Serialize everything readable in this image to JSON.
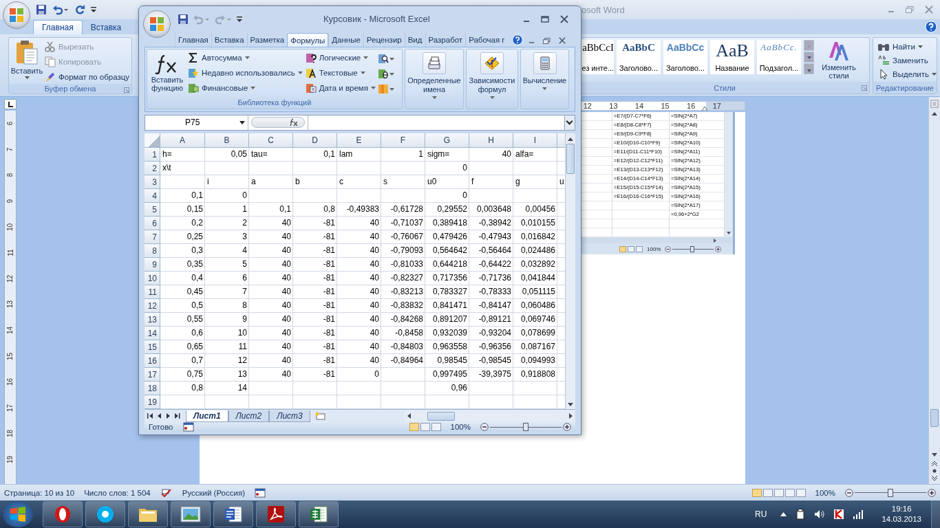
{
  "word": {
    "title": "osoft Word",
    "tabs": [
      {
        "label": "Главная",
        "selected": true
      },
      {
        "label": "Вставка",
        "selected": false
      }
    ],
    "clipboard": {
      "paste": "Вставить",
      "actions": [
        {
          "label": "Вырезать",
          "disabled": true,
          "kind": "cut"
        },
        {
          "label": "Копировать",
          "disabled": true,
          "kind": "copy"
        },
        {
          "label": "Формат по образцу",
          "disabled": false,
          "kind": "brush"
        }
      ],
      "group": "Буфер обмена"
    },
    "styles": {
      "items": [
        {
          "sample": "aBbCcI",
          "name": "ез инте...",
          "kind": "plain"
        },
        {
          "sample": "AaBbC",
          "name": "Заголово...",
          "kind": "heading1"
        },
        {
          "sample": "AaBbCc",
          "name": "Заголово...",
          "kind": "heading2"
        },
        {
          "sample": "AaB",
          "name": "Название",
          "kind": "title"
        },
        {
          "sample": "AaBbCc.",
          "name": "Подзагол...",
          "kind": "subtitle"
        }
      ],
      "change": "Изменить стили",
      "group": "Стили"
    },
    "editing": {
      "items": [
        {
          "label": "Найти",
          "kind": "find",
          "dropdown": true
        },
        {
          "label": "Заменить",
          "kind": "replace",
          "dropdown": false
        },
        {
          "label": "Выделить",
          "kind": "select",
          "dropdown": true
        }
      ],
      "group": "Редактирование"
    },
    "ruler": [
      "12",
      "13",
      "14",
      "15",
      "16",
      "17"
    ],
    "vertical_ruler": [
      "6",
      "7",
      "8",
      "9",
      "10",
      "11",
      "12",
      "13",
      "14",
      "15",
      "16",
      "17",
      "18",
      "19"
    ],
    "embedded": {
      "rows": [
        [
          "=E7/(D7-C7*F6)",
          "=SIN(2*A7)"
        ],
        [
          "=E8/(D8-C8*F7)",
          "=SIN(2*A8)"
        ],
        [
          "=E9/(D9-C9*F8)",
          "=SIN(2*A9)"
        ],
        [
          "=E10/(D10-C10*F9)",
          "=SIN(2*A10)"
        ],
        [
          "=E11/(D11-C11*F10)",
          "=SIN(2*A11)"
        ],
        [
          "=E12/(D12-C12*F11)",
          "=SIN(2*A12)"
        ],
        [
          "=E13/(D13-C13*F12)",
          "=SIN(2*A13)"
        ],
        [
          "=E14/(D14-C14*F13)",
          "=SIN(2*A14)"
        ],
        [
          "=E15/(D15-C15*F14)",
          "=SIN(2*A15)"
        ],
        [
          "=E16/(D16-C16*F15)",
          "=SIN(2*A16)"
        ],
        [
          null,
          "=SIN(2*A17)"
        ],
        [
          null,
          "=0,96+2*G2"
        ]
      ],
      "zoom": "100%",
      "zoom_slider": {
        "level": 0.5
      }
    },
    "status": {
      "page": "Страница: 10 из 10",
      "words": "Число слов: 1 504",
      "language": "Русский (Россия)",
      "zoom": "100%",
      "zoom_slider": {
        "level": 0.5
      }
    }
  },
  "excel": {
    "title": "Курсовик - Microsoft Excel",
    "tabs": [
      {
        "label": "Главная",
        "selected": false
      },
      {
        "label": "Вставка",
        "selected": false
      },
      {
        "label": "Разметка",
        "selected": false
      },
      {
        "label": "Формулы",
        "selected": true
      },
      {
        "label": "Данные",
        "selected": false
      },
      {
        "label": "Рецензир",
        "selected": false
      },
      {
        "label": "Вид",
        "selected": false
      },
      {
        "label": "Разработ",
        "selected": false
      },
      {
        "label": "Рабочая г",
        "selected": false
      }
    ],
    "library": {
      "insert": "Вставить функцию",
      "items": [
        {
          "label": "Автосумма",
          "kind": "sum"
        },
        {
          "label": "Недавно использовались",
          "kind": "recent"
        },
        {
          "label": "Финансовые",
          "kind": "finance"
        },
        {
          "label": "Логические",
          "kind": "logic"
        },
        {
          "label": "Текстовые",
          "kind": "text"
        },
        {
          "label": "Дата и время",
          "kind": "date"
        }
      ],
      "group": "Библиотека функций"
    },
    "groups": [
      {
        "label": "Определенные имена",
        "kind": "names"
      },
      {
        "label": "Зависимости формул",
        "kind": "audit"
      },
      {
        "label": "Вычисление",
        "kind": "calc"
      }
    ],
    "name_box": "P75",
    "columns": [
      "A",
      "B",
      "C",
      "D",
      "E",
      "F",
      "G",
      "H",
      "I"
    ],
    "rows": [
      {
        "n": "1",
        "cells": [
          {
            "text": "h=",
            "kind": "text"
          },
          {
            "text": "0,05",
            "kind": "number"
          },
          {
            "text": "tau=",
            "kind": "text"
          },
          {
            "text": "0,1",
            "kind": "number"
          },
          {
            "text": "lam",
            "kind": "text"
          },
          {
            "text": "1",
            "kind": "number"
          },
          {
            "text": "sigm=",
            "kind": "text"
          },
          {
            "text": "40",
            "kind": "number"
          },
          {
            "text": "alfa=",
            "kind": "text"
          },
          null
        ]
      },
      {
        "n": "2",
        "cells": [
          {
            "text": "x\\t",
            "kind": "text"
          },
          null,
          null,
          null,
          null,
          null,
          {
            "text": "0",
            "kind": "number"
          },
          null,
          null,
          null
        ]
      },
      {
        "n": "3",
        "cells": [
          null,
          {
            "text": "i",
            "kind": "text"
          },
          {
            "text": "a",
            "kind": "text"
          },
          {
            "text": "b",
            "kind": "text"
          },
          {
            "text": "c",
            "kind": "text"
          },
          {
            "text": "s",
            "kind": "text"
          },
          {
            "text": "u0",
            "kind": "text"
          },
          {
            "text": "f",
            "kind": "text"
          },
          {
            "text": "g",
            "kind": "text"
          },
          {
            "text": "u",
            "kind": "text"
          }
        ]
      },
      {
        "n": "4",
        "cells": [
          {
            "text": "0,1",
            "kind": "number"
          },
          {
            "text": "0",
            "kind": "number"
          },
          null,
          null,
          null,
          null,
          {
            "text": "0",
            "kind": "number"
          },
          null,
          null,
          null
        ]
      },
      {
        "n": "5",
        "cells": [
          {
            "text": "0,15",
            "kind": "number"
          },
          {
            "text": "1",
            "kind": "number"
          },
          {
            "text": "0,1",
            "kind": "number"
          },
          {
            "text": "0,8",
            "kind": "number"
          },
          {
            "text": "-0,49383",
            "kind": "number"
          },
          {
            "text": "-0,61728",
            "kind": "number"
          },
          {
            "text": "0,29552",
            "kind": "number"
          },
          {
            "text": "0,003648",
            "kind": "number"
          },
          {
            "text": "0,00456",
            "kind": "number"
          },
          null
        ]
      },
      {
        "n": "6",
        "cells": [
          {
            "text": "0,2",
            "kind": "number"
          },
          {
            "text": "2",
            "kind": "number"
          },
          {
            "text": "40",
            "kind": "number"
          },
          {
            "text": "-81",
            "kind": "number"
          },
          {
            "text": "40",
            "kind": "number"
          },
          {
            "text": "-0,71037",
            "kind": "number"
          },
          {
            "text": "0,389418",
            "kind": "number"
          },
          {
            "text": "-0,38942",
            "kind": "number"
          },
          {
            "text": "0,010155",
            "kind": "number"
          },
          null
        ]
      },
      {
        "n": "7",
        "cells": [
          {
            "text": "0,25",
            "kind": "number"
          },
          {
            "text": "3",
            "kind": "number"
          },
          {
            "text": "40",
            "kind": "number"
          },
          {
            "text": "-81",
            "kind": "number"
          },
          {
            "text": "40",
            "kind": "number"
          },
          {
            "text": "-0,76067",
            "kind": "number"
          },
          {
            "text": "0,479426",
            "kind": "number"
          },
          {
            "text": "-0,47943",
            "kind": "number"
          },
          {
            "text": "0,016842",
            "kind": "number"
          },
          null
        ]
      },
      {
        "n": "8",
        "cells": [
          {
            "text": "0,3",
            "kind": "number"
          },
          {
            "text": "4",
            "kind": "number"
          },
          {
            "text": "40",
            "kind": "number"
          },
          {
            "text": "-81",
            "kind": "number"
          },
          {
            "text": "40",
            "kind": "number"
          },
          {
            "text": "-0,79093",
            "kind": "number"
          },
          {
            "text": "0,564642",
            "kind": "number"
          },
          {
            "text": "-0,56464",
            "kind": "number"
          },
          {
            "text": "0,024486",
            "kind": "number"
          },
          null
        ]
      },
      {
        "n": "9",
        "cells": [
          {
            "text": "0,35",
            "kind": "number"
          },
          {
            "text": "5",
            "kind": "number"
          },
          {
            "text": "40",
            "kind": "number"
          },
          {
            "text": "-81",
            "kind": "number"
          },
          {
            "text": "40",
            "kind": "number"
          },
          {
            "text": "-0,81033",
            "kind": "number"
          },
          {
            "text": "0,644218",
            "kind": "number"
          },
          {
            "text": "-0,64422",
            "kind": "number"
          },
          {
            "text": "0,032892",
            "kind": "number"
          },
          null
        ]
      },
      {
        "n": "10",
        "cells": [
          {
            "text": "0,4",
            "kind": "number"
          },
          {
            "text": "6",
            "kind": "number"
          },
          {
            "text": "40",
            "kind": "number"
          },
          {
            "text": "-81",
            "kind": "number"
          },
          {
            "text": "40",
            "kind": "number"
          },
          {
            "text": "-0,82327",
            "kind": "number"
          },
          {
            "text": "0,717356",
            "kind": "number"
          },
          {
            "text": "-0,71736",
            "kind": "number"
          },
          {
            "text": "0,041844",
            "kind": "number"
          },
          null
        ]
      },
      {
        "n": "11",
        "cells": [
          {
            "text": "0,45",
            "kind": "number"
          },
          {
            "text": "7",
            "kind": "number"
          },
          {
            "text": "40",
            "kind": "number"
          },
          {
            "text": "-81",
            "kind": "number"
          },
          {
            "text": "40",
            "kind": "number"
          },
          {
            "text": "-0,83213",
            "kind": "number"
          },
          {
            "text": "0,783327",
            "kind": "number"
          },
          {
            "text": "-0,78333",
            "kind": "number"
          },
          {
            "text": "0,051115",
            "kind": "number"
          },
          null
        ]
      },
      {
        "n": "12",
        "cells": [
          {
            "text": "0,5",
            "kind": "number"
          },
          {
            "text": "8",
            "kind": "number"
          },
          {
            "text": "40",
            "kind": "number"
          },
          {
            "text": "-81",
            "kind": "number"
          },
          {
            "text": "40",
            "kind": "number"
          },
          {
            "text": "-0,83832",
            "kind": "number"
          },
          {
            "text": "0,841471",
            "kind": "number"
          },
          {
            "text": "-0,84147",
            "kind": "number"
          },
          {
            "text": "0,060486",
            "kind": "number"
          },
          null
        ]
      },
      {
        "n": "13",
        "cells": [
          {
            "text": "0,55",
            "kind": "number"
          },
          {
            "text": "9",
            "kind": "number"
          },
          {
            "text": "40",
            "kind": "number"
          },
          {
            "text": "-81",
            "kind": "number"
          },
          {
            "text": "40",
            "kind": "number"
          },
          {
            "text": "-0,84268",
            "kind": "number"
          },
          {
            "text": "0,891207",
            "kind": "number"
          },
          {
            "text": "-0,89121",
            "kind": "number"
          },
          {
            "text": "0,069746",
            "kind": "number"
          },
          null
        ]
      },
      {
        "n": "14",
        "cells": [
          {
            "text": "0,6",
            "kind": "number"
          },
          {
            "text": "10",
            "kind": "number"
          },
          {
            "text": "40",
            "kind": "number"
          },
          {
            "text": "-81",
            "kind": "number"
          },
          {
            "text": "40",
            "kind": "number"
          },
          {
            "text": "-0,8458",
            "kind": "number"
          },
          {
            "text": "0,932039",
            "kind": "number"
          },
          {
            "text": "-0,93204",
            "kind": "number"
          },
          {
            "text": "0,078699",
            "kind": "number"
          },
          null
        ]
      },
      {
        "n": "15",
        "cells": [
          {
            "text": "0,65",
            "kind": "number"
          },
          {
            "text": "11",
            "kind": "number"
          },
          {
            "text": "40",
            "kind": "number"
          },
          {
            "text": "-81",
            "kind": "number"
          },
          {
            "text": "40",
            "kind": "number"
          },
          {
            "text": "-0,84803",
            "kind": "number"
          },
          {
            "text": "0,963558",
            "kind": "number"
          },
          {
            "text": "-0,96356",
            "kind": "number"
          },
          {
            "text": "0,087167",
            "kind": "number"
          },
          null
        ]
      },
      {
        "n": "16",
        "cells": [
          {
            "text": "0,7",
            "kind": "number"
          },
          {
            "text": "12",
            "kind": "number"
          },
          {
            "text": "40",
            "kind": "number"
          },
          {
            "text": "-81",
            "kind": "number"
          },
          {
            "text": "40",
            "kind": "number"
          },
          {
            "text": "-0,84964",
            "kind": "number"
          },
          {
            "text": "0,98545",
            "kind": "number"
          },
          {
            "text": "-0,98545",
            "kind": "number"
          },
          {
            "text": "0,094993",
            "kind": "number"
          },
          null
        ]
      },
      {
        "n": "17",
        "cells": [
          {
            "text": "0,75",
            "kind": "number"
          },
          {
            "text": "13",
            "kind": "number"
          },
          {
            "text": "40",
            "kind": "number"
          },
          {
            "text": "-81",
            "kind": "number"
          },
          {
            "text": "0",
            "kind": "number"
          },
          null,
          {
            "text": "0,997495",
            "kind": "number"
          },
          {
            "text": "-39,3975",
            "kind": "number"
          },
          {
            "text": "0,918808",
            "kind": "number"
          },
          null
        ]
      },
      {
        "n": "18",
        "cells": [
          {
            "text": "0,8",
            "kind": "number"
          },
          {
            "text": "14",
            "kind": "number"
          },
          null,
          null,
          null,
          null,
          {
            "text": "0,96",
            "kind": "number"
          },
          null,
          null,
          null
        ]
      },
      {
        "n": "19",
        "cells": [
          null,
          null,
          null,
          null,
          null,
          null,
          null,
          null,
          null,
          null
        ]
      }
    ],
    "sheets": [
      {
        "label": "Лист1",
        "selected": true
      },
      {
        "label": "Лист2",
        "selected": false
      },
      {
        "label": "Лист3",
        "selected": false
      }
    ],
    "status": "Готово",
    "zoom": "100%",
    "zoom_slider": {
      "level": 0.5
    }
  },
  "taskbar": {
    "apps": [
      {
        "kind": "opera"
      },
      {
        "kind": "skype"
      },
      {
        "kind": "explorer"
      },
      {
        "kind": "photos"
      },
      {
        "kind": "word"
      },
      {
        "kind": "acrobat"
      },
      {
        "kind": "excel"
      }
    ],
    "language": "RU",
    "time": "19:16",
    "date": "14.03.2013"
  }
}
